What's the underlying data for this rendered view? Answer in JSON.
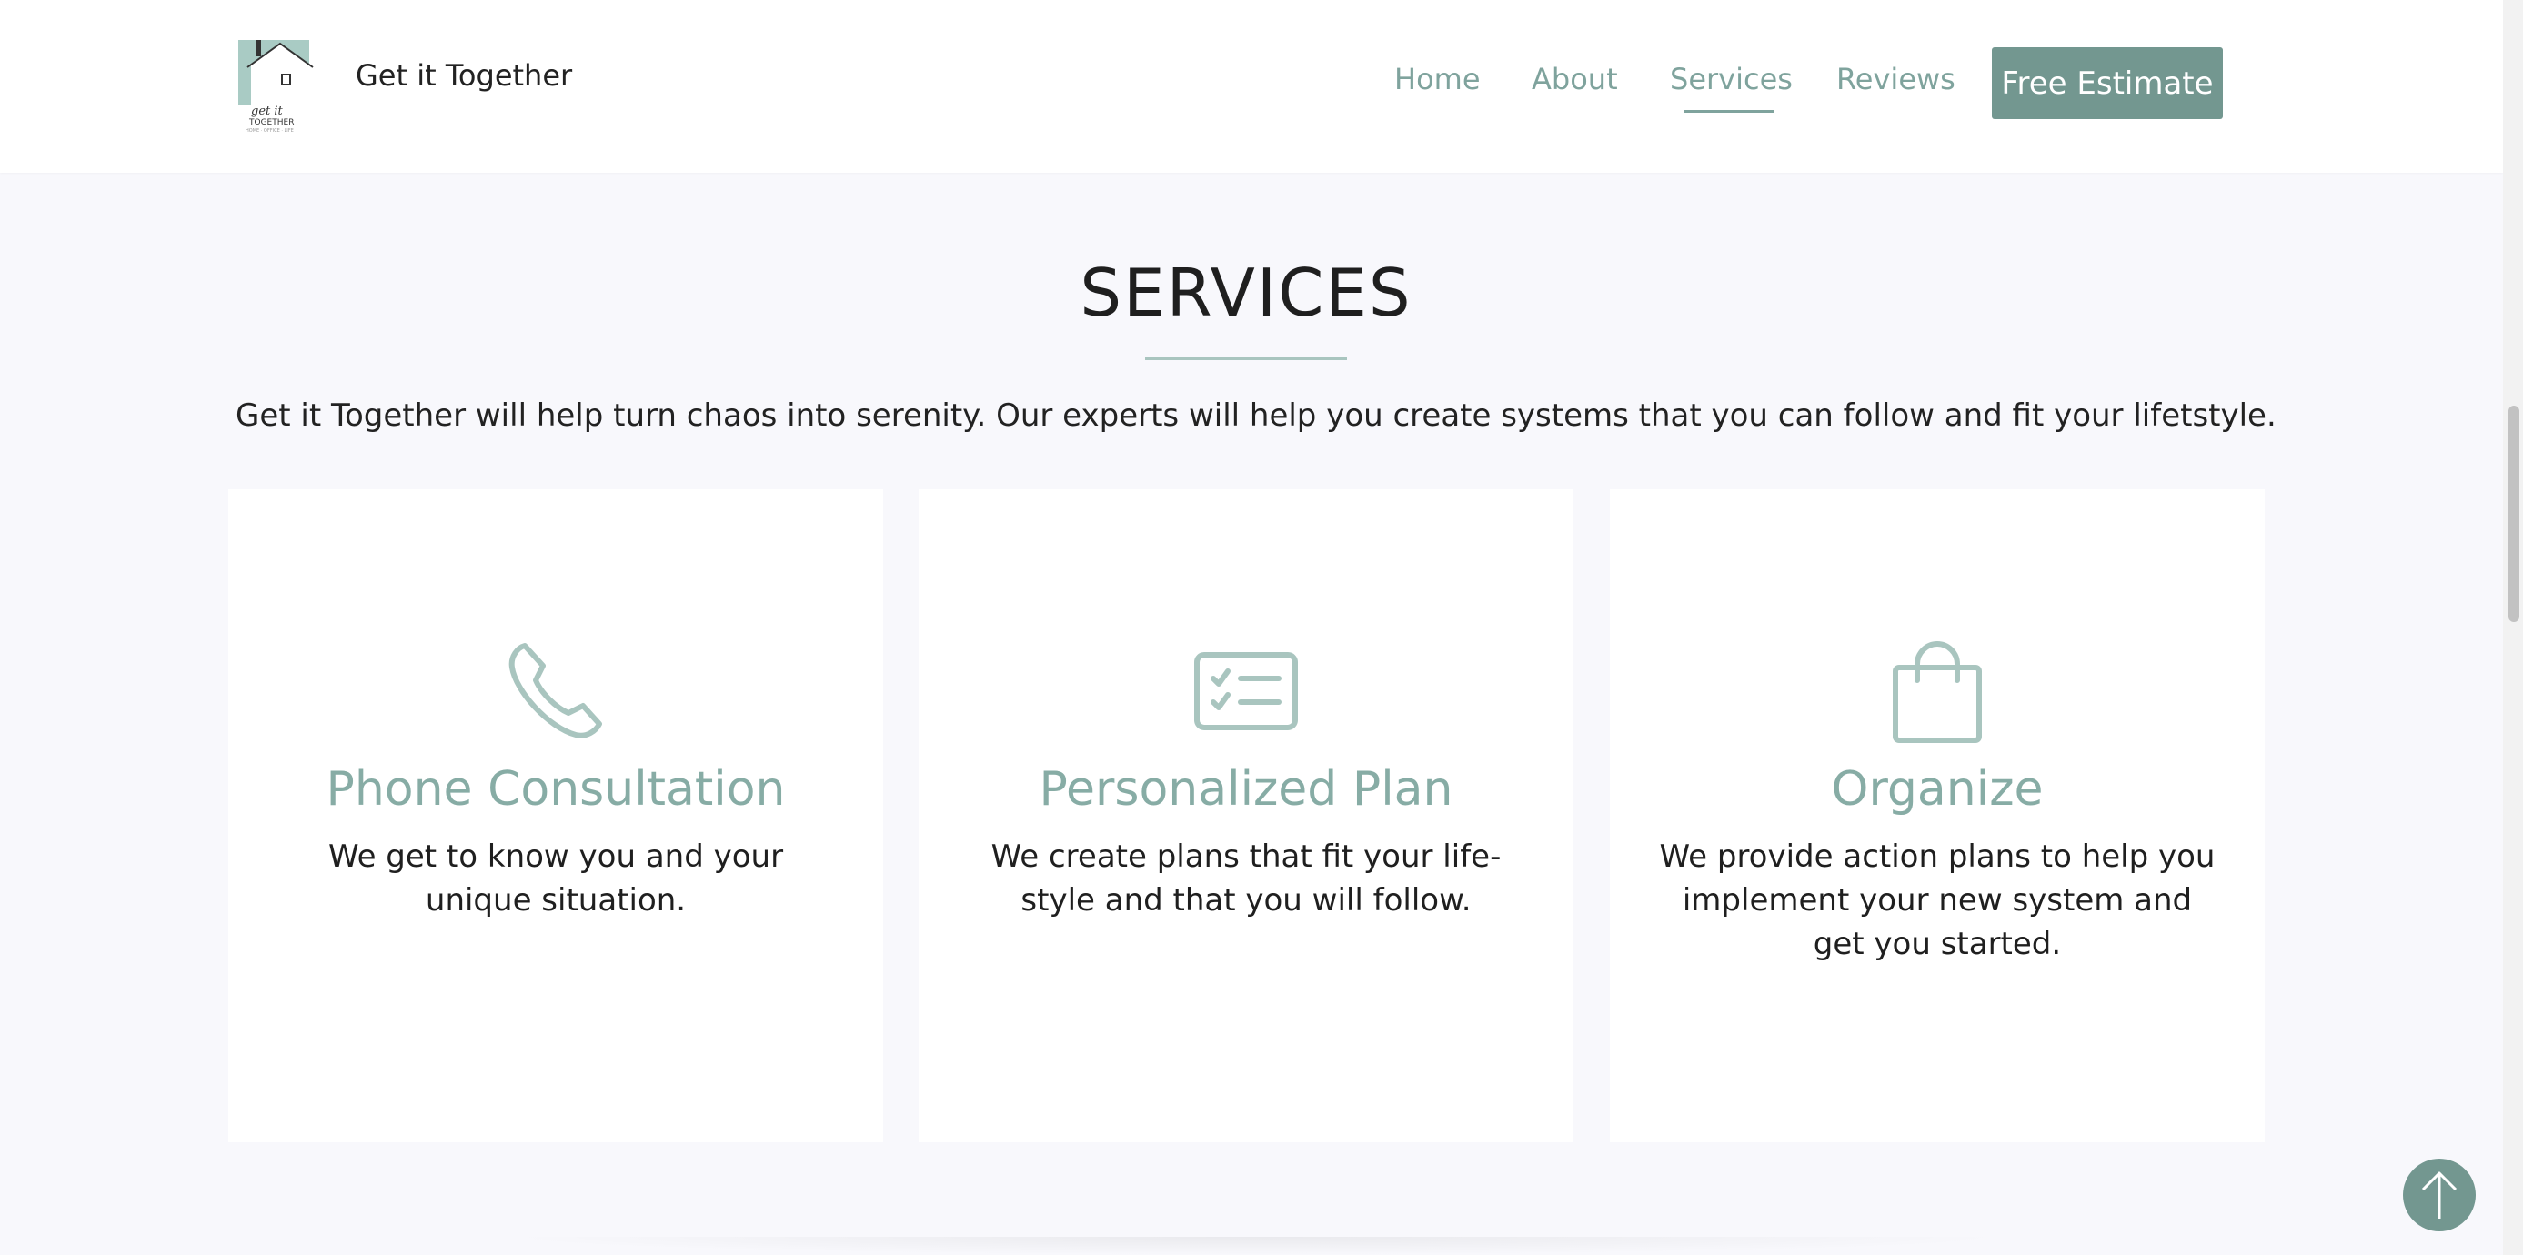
{
  "header": {
    "site_name": "Get it Together",
    "logo_icon": "house-logo-icon",
    "nav": [
      {
        "label": "Home"
      },
      {
        "label": "About"
      },
      {
        "label": "Services",
        "active": true
      },
      {
        "label": "Reviews"
      }
    ],
    "cta_label": "Free Estimate"
  },
  "section": {
    "title": "SERVICES",
    "intro": "Get it Together will help turn chaos into serenity. Our experts will help you create systems that you can follow and fit your lifetstyle."
  },
  "cards": [
    {
      "icon": "phone-icon",
      "title": "Phone Consultation",
      "desc": "We get to know you and your unique situation."
    },
    {
      "icon": "checklist-icon",
      "title": "Personalized Plan",
      "desc": "We create plans that fit your life-style and that you will follow."
    },
    {
      "icon": "shopping-bag-icon",
      "title": "Organize",
      "desc": "We provide action plans to help you implement your new system and get you started."
    }
  ],
  "colors": {
    "accent": "#7fa39d",
    "button": "#739790",
    "page_bg": "#f8f8fc",
    "card_bg": "#ffffff"
  },
  "back_to_top_icon": "arrow-up-icon"
}
